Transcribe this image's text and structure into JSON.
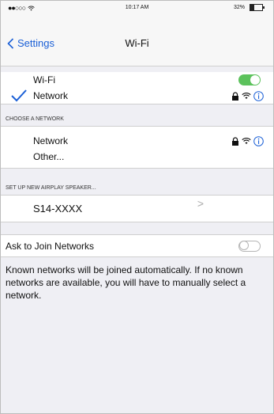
{
  "status": {
    "carrier": "●●○○○",
    "time": "10:17 AM",
    "battery": "32%",
    "battery_level": 0.32
  },
  "nav": {
    "back_label": "Settings",
    "title": "Wi-Fi"
  },
  "wifi": {
    "label": "Wi-Fi",
    "on": true,
    "connected_network": "Network"
  },
  "choose": {
    "header": "CHOOSE A NETWORK",
    "networks": [
      "Network"
    ],
    "other": "Other..."
  },
  "airplay": {
    "header": "SET UP NEW AIRPLAY SPEAKER...",
    "device": "S14-XXXX",
    "chevron": ">"
  },
  "ask": {
    "label": "Ask to Join Networks",
    "on": false
  },
  "footer": {
    "text": "Known networks will be joined automatically. If no known networks are available, you will have to manually select a network."
  },
  "colors": {
    "accent": "#1a5fd6",
    "toggle_on": "#5cc25c",
    "group_bg": "#efeff4"
  }
}
